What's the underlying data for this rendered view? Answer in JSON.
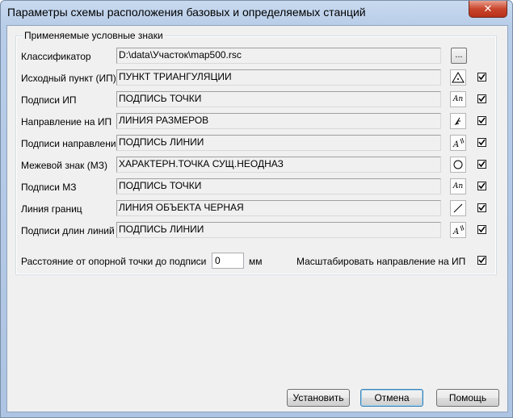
{
  "window": {
    "title": "Параметры схемы расположения базовых и определяемых станций",
    "close_symbol": "✕"
  },
  "group": {
    "legend": "Применяемые условные знаки"
  },
  "rows": [
    {
      "label": "Классификатор",
      "value": "D:\\data\\Участок\\map500.rsc",
      "button": "...",
      "icon": "browse-button"
    },
    {
      "label": "Исходный пункт (ИП)",
      "value": "ПУНКТ ТРИАНГУЛЯЦИИ",
      "icon": "triangle-icon",
      "checked": true
    },
    {
      "label": "Подписи ИП",
      "value": "ПОДПИСЬ ТОЧКИ",
      "icon": "text-label-icon",
      "icon_text": "An",
      "checked": true
    },
    {
      "label": "Направление на ИП",
      "value": "ЛИНИЯ РАЗМЕРОВ",
      "icon": "direction-arrow-icon",
      "checked": true
    },
    {
      "label": "Подписи направлений",
      "value": "ПОДПИСЬ ЛИНИИ",
      "icon": "line-label-icon",
      "icon_text": "A",
      "checked": true
    },
    {
      "label": "Межевой знак (МЗ)",
      "value": "ХАРАКТЕРН.ТОЧКА СУЩ.НЕОДНАЗ",
      "icon": "circle-icon",
      "checked": true
    },
    {
      "label": "Подписи МЗ",
      "value": "ПОДПИСЬ ТОЧКИ",
      "icon": "text-label-icon",
      "icon_text": "An",
      "checked": true
    },
    {
      "label": "Линия границ",
      "value": "ЛИНИЯ ОБЪЕКТА ЧЕРНАЯ",
      "icon": "diagonal-line-icon",
      "checked": true
    },
    {
      "label": "Подписи длин линий",
      "value": "ПОДПИСЬ ЛИНИИ",
      "icon": "line-label-icon",
      "icon_text": "A",
      "checked": true
    }
  ],
  "distance": {
    "label": "Расстояние от опорной точки до подписи",
    "value": "0",
    "unit": "мм"
  },
  "scale_direction": {
    "label": "Масштабировать направление на ИП",
    "checked": true
  },
  "buttons": {
    "apply": "Установить",
    "cancel": "Отмена",
    "help": "Помощь"
  }
}
